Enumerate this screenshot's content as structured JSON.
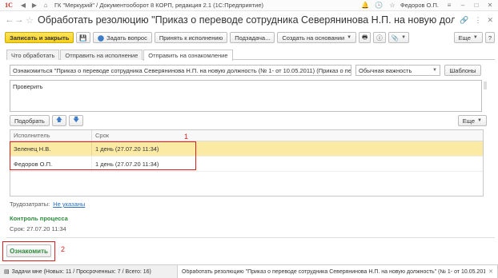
{
  "titlebar": {
    "logo": "1С",
    "app_title": "ГК \"Меркурий\" / Документооборот 8 КОРП, редакция 2.1  (1С:Предприятие)",
    "user": "Федоров О.П.",
    "icons": [
      "back-icon",
      "forward-icon",
      "home-icon",
      "star-icon",
      "bell-icon",
      "history-icon",
      "user-icon",
      "menu-icon",
      "minimize-icon",
      "maximize-icon",
      "close-icon"
    ]
  },
  "header": {
    "title": "Обработать резолюцию \"Приказ о переводе сотрудника Северянинова Н.П. на новую должность\" (№ 1- от 10.05.2011)"
  },
  "toolbar": {
    "save_close": "Записать и закрыть",
    "ask": "Задать вопрос",
    "accept": "Принять к исполнению",
    "subtask": "Подзадача...",
    "create_basis": "Создать на основании",
    "more": "Еще"
  },
  "tabs": [
    {
      "label": "Что обработать",
      "active": false
    },
    {
      "label": "Отправить на исполнение",
      "active": false
    },
    {
      "label": "Отправить на ознакомление",
      "active": true
    }
  ],
  "form": {
    "subject": "Ознакомиться \"Приказ о переводе сотрудника Северянинова Н.П. на новую должность (№ 1- от 10.05.2011) (Приказ о перев",
    "importance": "Обычная важность",
    "templates_btn": "Шаблоны",
    "comment": "Проверить",
    "select_btn": "Подобрать",
    "up_arrow": "🡅",
    "down_arrow": "🡇",
    "more_btn": "Еще"
  },
  "table": {
    "columns": [
      "Исполнитель",
      "Срок"
    ],
    "rows": [
      {
        "executor": "Зеленец Н.В.",
        "term": "1 день (27.07.20 11:34)",
        "selected": true
      },
      {
        "executor": "Федоров О.П.",
        "term": "1 день (27.07.20 11:34)",
        "selected": false
      }
    ]
  },
  "annotations": {
    "n1": "1",
    "n2": "2"
  },
  "labor": {
    "label": "Трудозатраты:",
    "value": "Не указаны"
  },
  "control": {
    "title": "Контроль процесса",
    "term_label": "Срок:",
    "term_value": "27.07.20 11:34"
  },
  "bottom": {
    "acquaint_btn": "Ознакомить"
  },
  "taskbar": {
    "item1": "Задачи мне (Новых: 11 / Просроченных: 7 / Всего: 16)",
    "item2": "Обработать резолюцию \"Приказ о переводе сотрудника Северянинова Н.П. на новую должность\" (№ 1- от 10.05.2011)"
  },
  "colors": {
    "primary_button": "#f5d019",
    "selected_row": "#fbeaa3",
    "annotation_red": "#e21e1e",
    "green_text": "#2e8a3c",
    "link": "#2b6fc4"
  }
}
